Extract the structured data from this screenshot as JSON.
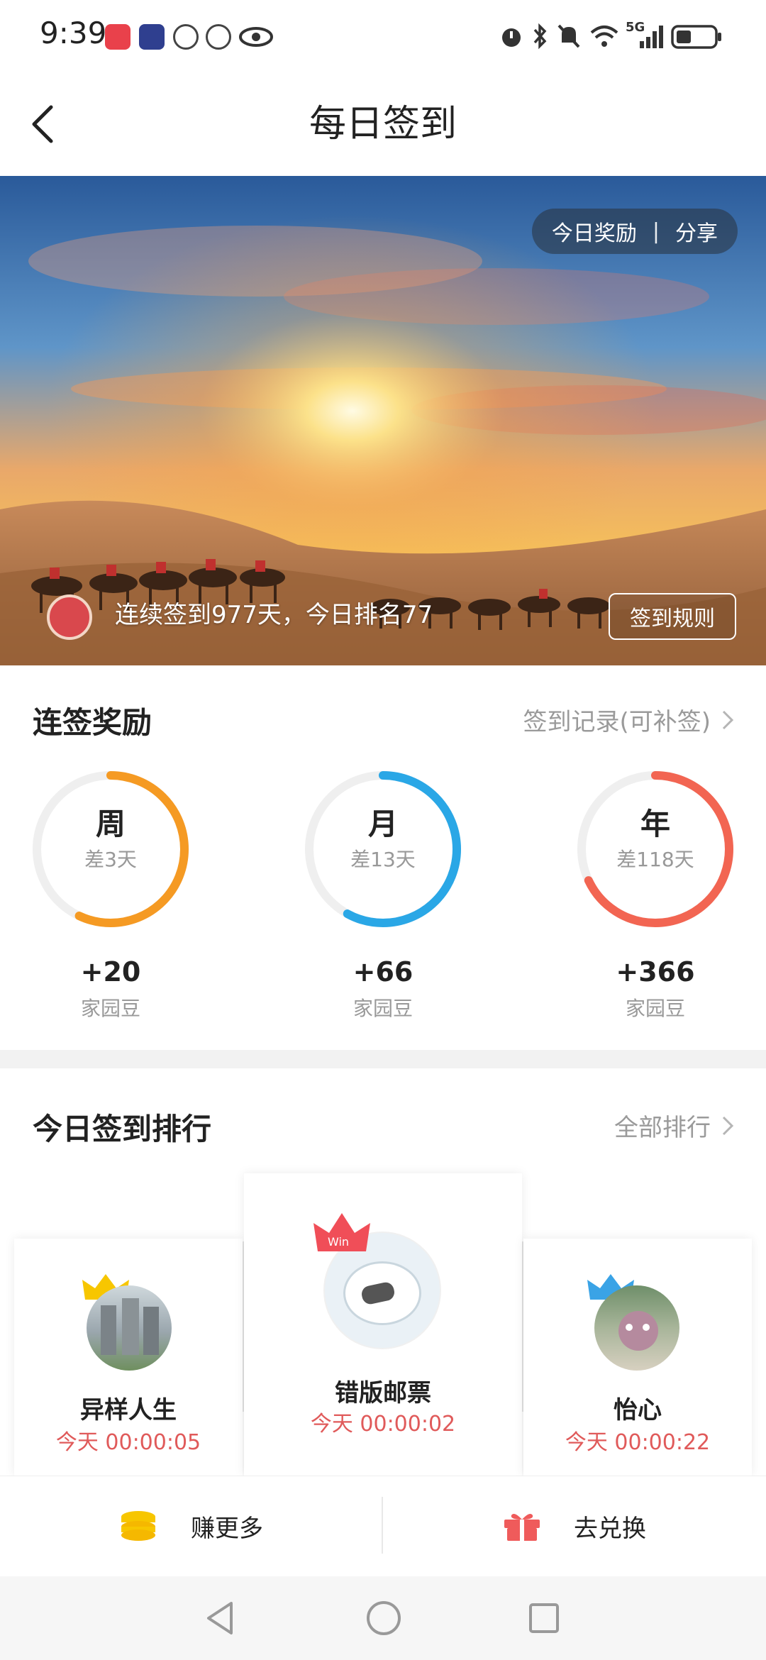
{
  "status_bar": {
    "time": "9:39",
    "network": "5G",
    "icons": [
      "alarm-icon",
      "bluetooth-icon",
      "mute-icon",
      "wifi-icon",
      "signal-icon",
      "battery-icon"
    ]
  },
  "header": {
    "title": "每日签到",
    "back_icon": "back-icon"
  },
  "banner": {
    "today_reward": "今日奖励",
    "separator": "|",
    "share": "分享",
    "streak_text": "连续签到977天，今日排名77",
    "rules_button": "签到规则"
  },
  "rewards": {
    "title": "连签奖励",
    "record_link": "签到记录(可补签)",
    "items": [
      {
        "label": "周",
        "remaining": "差3天",
        "points": "+20",
        "unit": "家园豆",
        "progress": 0.57,
        "color": "#f59a23"
      },
      {
        "label": "月",
        "remaining": "差13天",
        "points": "+66",
        "unit": "家园豆",
        "progress": 0.58,
        "color": "#2aa7e6"
      },
      {
        "label": "年",
        "remaining": "差118天",
        "points": "+366",
        "unit": "家园豆",
        "progress": 0.68,
        "color": "#f26552"
      }
    ]
  },
  "ranking": {
    "title": "今日签到排行",
    "all_link": "全部排行",
    "entries": [
      {
        "position": "second",
        "name": "异样人生",
        "time": "今天 00:00:05"
      },
      {
        "position": "first",
        "name": "错版邮票",
        "time": "今天 00:00:02"
      },
      {
        "position": "third",
        "name": "怡心",
        "time": "今天 00:00:22"
      }
    ]
  },
  "bottom_bar": {
    "earn_more": "赚更多",
    "exchange": "去兑换"
  },
  "colors": {
    "accent_red": "#e05a5a",
    "gold": "#f7c600",
    "gift": "#ef5b5b"
  }
}
